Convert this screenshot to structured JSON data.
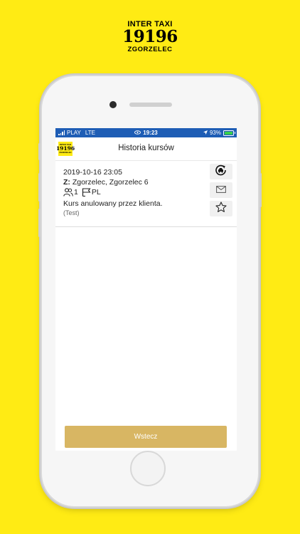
{
  "brand": {
    "line1": "INTER TAXI",
    "line2": "19196",
    "line3": "ZGORZELEC"
  },
  "statusbar": {
    "carrier": "PLAY",
    "network": "LTE",
    "time": "19:23",
    "battery": "93%"
  },
  "appbar": {
    "logo": {
      "line1": "INTER TAXI",
      "line2": "19196",
      "line3": "ZGORZELEC"
    },
    "title": "Historia kursów"
  },
  "ride": {
    "datetime": "2019-10-16 23:05",
    "from_label": "Z:",
    "from_value": " Zgorzelec, Zgorzelec 6",
    "passengers": "1",
    "language": "PL",
    "status": "Kurs anulowany przez klienta.",
    "note": "(Test)",
    "actions": [
      "reorder-taxi-icon",
      "mail-icon",
      "star-icon"
    ]
  },
  "footer": {
    "back_label": "Wstecz"
  },
  "colors": {
    "background": "#FFEB14",
    "statusbar": "#1E5DB5",
    "button": "#D8B663"
  }
}
